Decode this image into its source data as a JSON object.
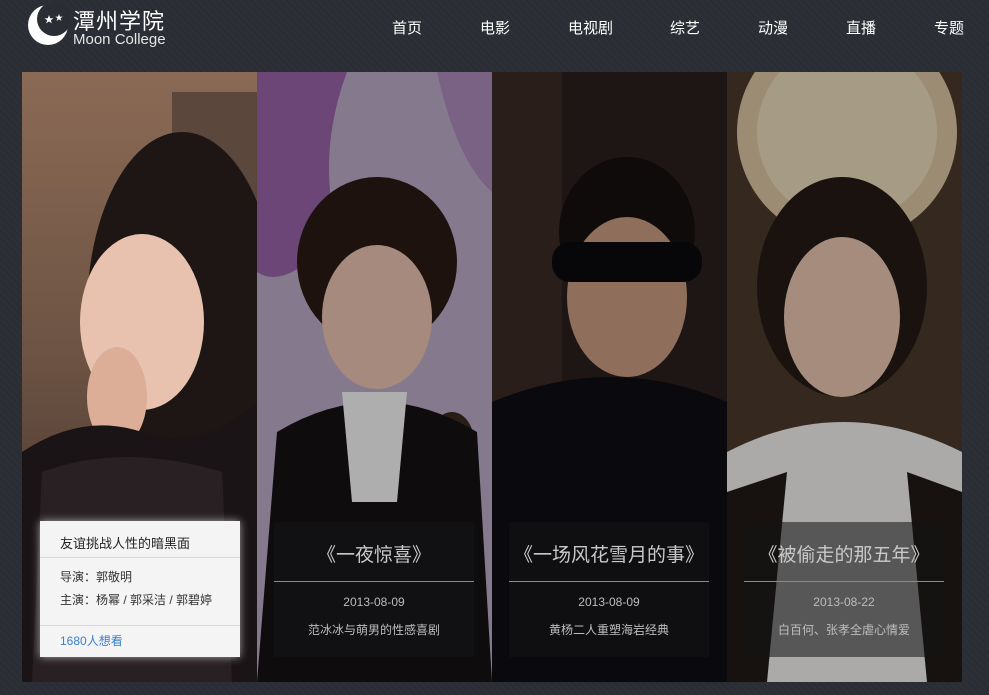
{
  "site": {
    "name_cn": "潭州学院",
    "name_en": "Moon College"
  },
  "nav": [
    "首页",
    "电影",
    "电视剧",
    "综艺",
    "动漫",
    "直播",
    "专题"
  ],
  "featured": {
    "title": "友谊挑战人性的暗黑面",
    "director": "导演：郭敬明",
    "cast": "主演：杨幂 / 郭采洁 / 郭碧婷",
    "want": "1680人想看"
  },
  "movies": [
    {
      "title": "《一夜惊喜》",
      "date": "2013-08-09",
      "desc": "范冰冰与萌男的性感喜剧"
    },
    {
      "title": "《一场风花雪月的事》",
      "date": "2013-08-09",
      "desc": "黄杨二人重塑海岩经典"
    },
    {
      "title": "《被偷走的那五年》",
      "date": "2013-08-22",
      "desc": "白百何、张孝全虐心情爱"
    }
  ],
  "colors": {
    "background": "#2a2d33",
    "link": "#3a7fd0"
  }
}
